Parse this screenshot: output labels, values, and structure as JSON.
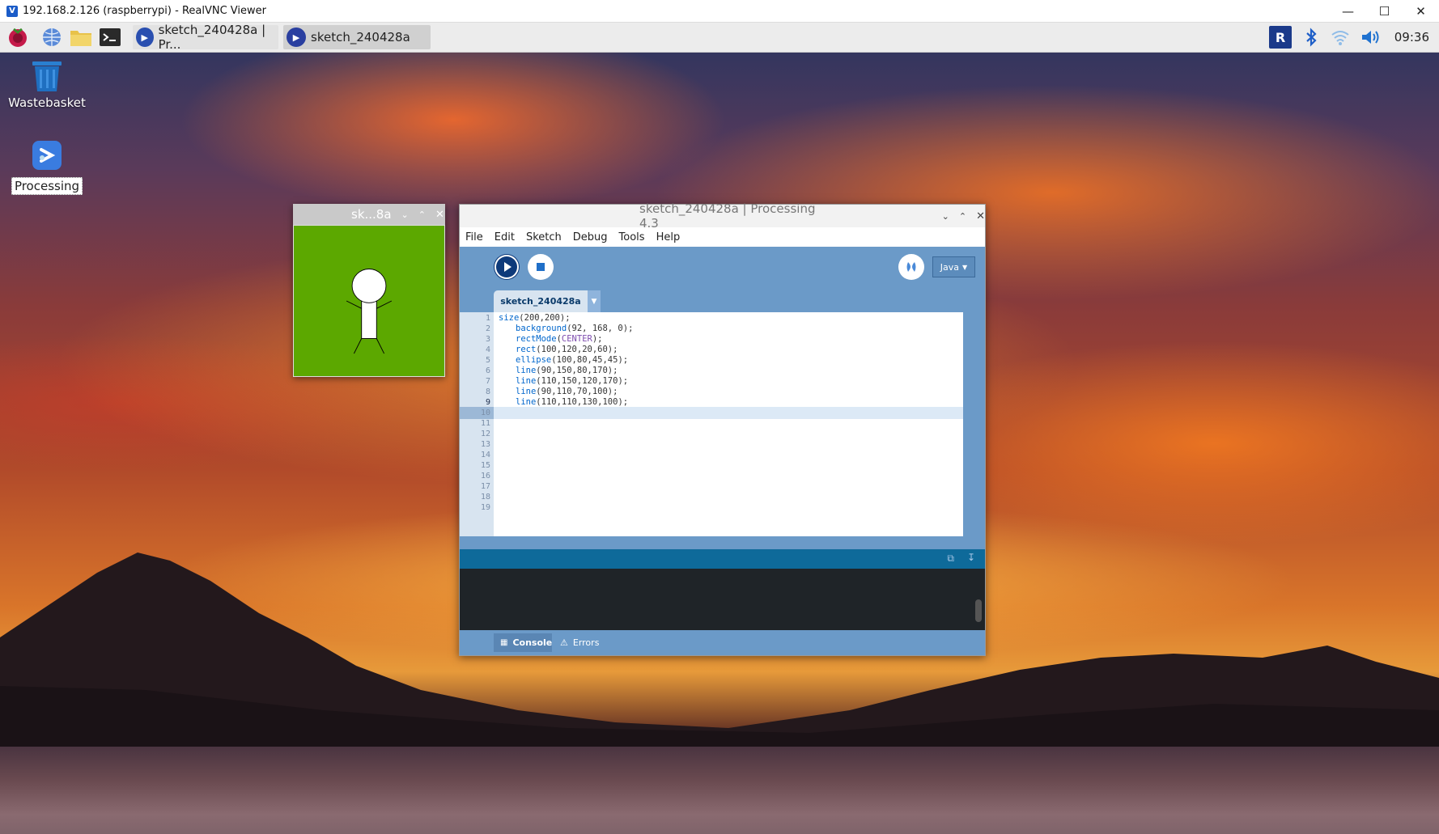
{
  "vnc": {
    "title": "192.168.2.126 (raspberrypi) - RealVNC Viewer"
  },
  "taskbar": {
    "tasks": [
      {
        "label": "sketch_240428a | Pr..."
      },
      {
        "label": "sketch_240428a"
      }
    ],
    "clock": "09:36"
  },
  "desktop": {
    "icons": [
      {
        "label": "Wastebasket"
      },
      {
        "label": "Processing"
      }
    ]
  },
  "sketch_window": {
    "title": "sk...8a",
    "background_color": "#5ca800"
  },
  "ide": {
    "title": "sketch_240428a | Processing 4.3",
    "menus": [
      "File",
      "Edit",
      "Sketch",
      "Debug",
      "Tools",
      "Help"
    ],
    "mode": "Java",
    "tab": "sketch_240428a",
    "line_numbers": [
      "1",
      "2",
      "3",
      "4",
      "5",
      "6",
      "7",
      "8",
      "9",
      "10",
      "11",
      "12",
      "13",
      "14",
      "15",
      "16",
      "17",
      "18",
      "19"
    ],
    "code": [
      {
        "fn": "size",
        "args": "(200,200);"
      },
      {
        "fn": "background",
        "args": "(92, 168, 0);"
      },
      {
        "fn": "rectMode",
        "pre": "(",
        "const": "CENTER",
        "post": ");"
      },
      {
        "fn": "rect",
        "args": "(100,120,20,60);"
      },
      {
        "fn": "ellipse",
        "args": "(100,80,45,45);"
      },
      {
        "fn": "line",
        "args": "(90,150,80,170);"
      },
      {
        "fn": "line",
        "args": "(110,150,120,170);"
      },
      {
        "fn": "line",
        "args": "(90,110,70,100);"
      },
      {
        "fn": "line",
        "args": "(110,110,130,100);"
      }
    ],
    "current_line": "9",
    "console_tabs": [
      "Console",
      "Errors"
    ]
  }
}
